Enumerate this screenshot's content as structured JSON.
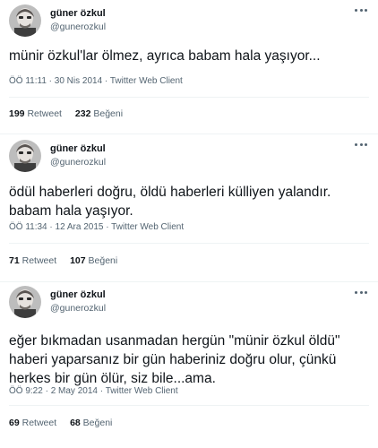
{
  "tweets": [
    {
      "name": "güner özkul",
      "handle": "@gunerozkul",
      "text": "münir özkul'lar ölmez, ayrıca babam hala yaşıyor...",
      "time": "ÖÖ 11:11",
      "date": "30 Nis 2014",
      "client": "Twitter Web Client",
      "retweets": "199",
      "retweet_label": "Retweet",
      "likes": "232",
      "like_label": "Beğeni"
    },
    {
      "name": "güner özkul",
      "handle": "@gunerozkul",
      "text": "ödül haberleri doğru, öldü haberleri külliyen yalandır.\nbabam hala yaşıyor.",
      "time": "ÖÖ 11:34",
      "date": "12 Ara 2015",
      "client": "Twitter Web Client",
      "retweets": "71",
      "retweet_label": "Retweet",
      "likes": "107",
      "like_label": "Beğeni"
    },
    {
      "name": "güner özkul",
      "handle": "@gunerozkul",
      "text": "eğer bıkmadan usanmadan hergün \"münir özkul öldü\"\nhaberi yaparsanız bir gün haberiniz doğru olur, çünkü\nherkes bir gün ölür, siz bile...ama.",
      "time": "ÖÖ 9:22",
      "date": "2 May 2014",
      "client": "Twitter Web Client",
      "retweets": "69",
      "retweet_label": "Retweet",
      "likes": "68",
      "like_label": "Beğeni"
    }
  ],
  "icons": {
    "more": "more-horizontal-icon",
    "avatar": "profile-photo"
  },
  "colors": {
    "text_primary": "#0f1419",
    "text_secondary": "#536471",
    "divider": "#eff3f4",
    "background": "#ffffff"
  }
}
